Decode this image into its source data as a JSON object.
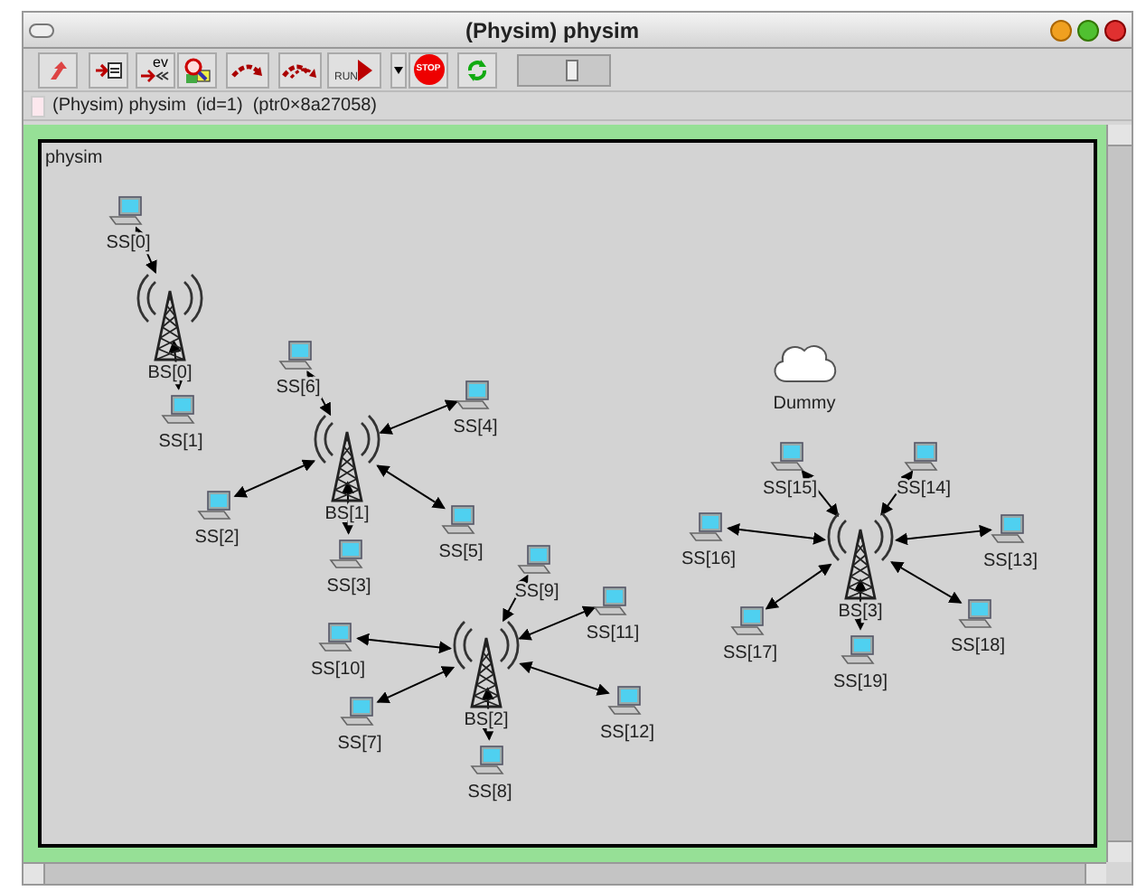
{
  "window": {
    "title": "(Physim) physim"
  },
  "toolbar": [
    {
      "kind": "up"
    },
    {
      "kind": "log"
    },
    {
      "kind": "eventlog",
      "text": "ev"
    },
    {
      "kind": "inspect"
    },
    {
      "kind": "step"
    },
    {
      "kind": "fast"
    },
    {
      "kind": "run",
      "text": "RUN"
    },
    {
      "kind": "menu"
    },
    {
      "kind": "stop",
      "text": "STOP"
    },
    {
      "kind": "refresh"
    },
    {
      "kind": "slider",
      "level": 0.6
    }
  ],
  "info": "(Physim) physim  (id=1)  (ptr0×8a27058)",
  "network": {
    "title": "physim",
    "stations": [
      {
        "label": "BS[0]",
        "hosts": [
          {
            "label": "SS[0]"
          },
          {
            "label": "SS[1]"
          }
        ]
      },
      {
        "label": "BS[1]",
        "hosts": [
          {
            "label": "SS[6]"
          },
          {
            "label": "SS[4]"
          },
          {
            "label": "SS[2]"
          },
          {
            "label": "SS[5]"
          },
          {
            "label": "SS[3]"
          }
        ]
      },
      {
        "label": "BS[2]",
        "hosts": [
          {
            "label": "SS[9]"
          },
          {
            "label": "SS[11]"
          },
          {
            "label": "SS[10]"
          },
          {
            "label": "SS[7]"
          },
          {
            "label": "SS[12]"
          },
          {
            "label": "SS[8]"
          }
        ]
      },
      {
        "label": "BS[3]",
        "hosts": [
          {
            "label": "SS[15]"
          },
          {
            "label": "SS[14]"
          },
          {
            "label": "SS[16]"
          },
          {
            "label": "SS[13]"
          },
          {
            "label": "SS[17]"
          },
          {
            "label": "SS[18]"
          },
          {
            "label": "SS[19]"
          }
        ]
      }
    ],
    "others": [
      {
        "kind": "cloud",
        "label": "Dummy"
      }
    ]
  }
}
